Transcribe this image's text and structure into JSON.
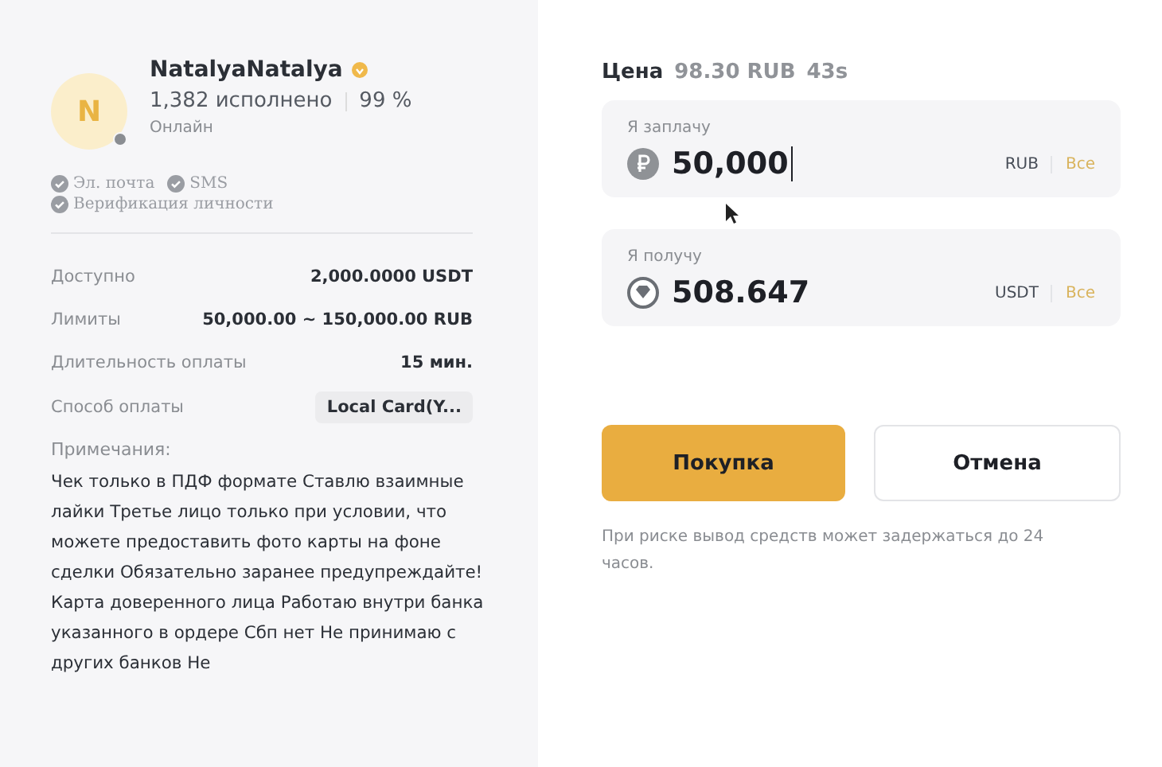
{
  "merchant": {
    "avatar_letter": "N",
    "name": "NatalyaNatalya",
    "orders": "1,382 исполнено",
    "completion": "99 %",
    "status": "Онлайн"
  },
  "verifications": [
    {
      "label": "Эл. почта",
      "checked": true
    },
    {
      "label": "SMS",
      "checked": true
    },
    {
      "label": "Верификация личности",
      "checked": true
    }
  ],
  "details": [
    {
      "label": "Доступно",
      "value": "2,000.0000 USDT",
      "kind": "text"
    },
    {
      "label": "Лимиты",
      "value": "50,000.00 ~ 150,000.00 RUB",
      "kind": "text"
    },
    {
      "label": "Длительность оплаты",
      "value": "15 мин.",
      "kind": "text"
    },
    {
      "label": "Способ оплаты",
      "value": "Local Card(Y...",
      "kind": "tag"
    }
  ],
  "notes": {
    "label": "Примечания:",
    "text": "Чек только в ПДФ формате Ставлю взаимные лайки Третье лицо только при условии, что можете предоставить фото карты на фоне сделки Обязательно заранее предупреждайте! Карта доверенного лица Работаю внутри банка указанного в ордере Сбп нет Не принимаю с других банков Не"
  },
  "price": {
    "label": "Цена",
    "value": "98.30 RUB",
    "timer": "43s"
  },
  "amounts": [
    {
      "label": "Я заплачу",
      "value": "50,000",
      "currency": "RUB",
      "all": "Все",
      "kind": "rub",
      "focused": true
    },
    {
      "label": "Я получу",
      "value": "508.647",
      "currency": "USDT",
      "all": "Все",
      "kind": "usdt",
      "focused": false
    }
  ],
  "buttons": [
    {
      "label": "Покупка",
      "kind": "primary"
    },
    {
      "label": "Отмена",
      "kind": "secondary"
    }
  ],
  "risk_note": "При риске вывод средств может задержаться до 24 часов."
}
